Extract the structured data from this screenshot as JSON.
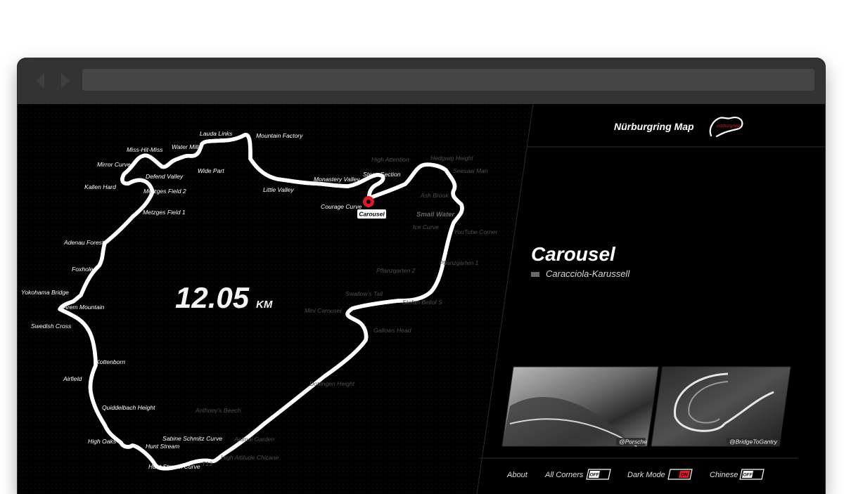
{
  "browser": {
    "back_icon": "chevron-left-icon",
    "forward_icon": "chevron-right-icon",
    "url": ""
  },
  "map": {
    "distance_value": "12.05",
    "distance_unit": "KM",
    "selected_marker_label": "Carousel",
    "corners": [
      {
        "name": "Lauda Links",
        "active": true
      },
      {
        "name": "Mountain Factory",
        "active": true
      },
      {
        "name": "Miss-Hit-Miss",
        "active": true
      },
      {
        "name": "Water Mill",
        "active": true
      },
      {
        "name": "Mirror Curve",
        "active": true
      },
      {
        "name": "Wide Part",
        "active": true
      },
      {
        "name": "Defend Valley",
        "active": true
      },
      {
        "name": "Kallen Hard",
        "active": true
      },
      {
        "name": "Metzges Field 2",
        "active": true
      },
      {
        "name": "Little Valley",
        "active": true
      },
      {
        "name": "Monastery Valley",
        "active": true
      },
      {
        "name": "Steep Section",
        "active": true
      },
      {
        "name": "Courage Curve",
        "active": true
      },
      {
        "name": "Metzges Field 1",
        "active": true
      },
      {
        "name": "Adenau Forest",
        "active": true
      },
      {
        "name": "Foxhole",
        "active": true
      },
      {
        "name": "Yokohama Bridge",
        "active": true
      },
      {
        "name": "Arem Mountain",
        "active": true
      },
      {
        "name": "Swedish Cross",
        "active": true
      },
      {
        "name": "Kottenborn",
        "active": true
      },
      {
        "name": "Airfield",
        "active": true
      },
      {
        "name": "Quiddelbach Height",
        "active": true
      },
      {
        "name": "High Oaks",
        "active": true
      },
      {
        "name": "Sabine Schmitz Curve",
        "active": true
      },
      {
        "name": "Hunt Stream",
        "active": true
      },
      {
        "name": "Hunt Stream Curve",
        "active": true
      },
      {
        "name": "High Attention",
        "active": false
      },
      {
        "name": "Hedgwig Height",
        "active": false
      },
      {
        "name": "Seesaw Man",
        "active": false
      },
      {
        "name": "Ash Brook",
        "active": false
      },
      {
        "name": "Small Water",
        "active": false
      },
      {
        "name": "Ice Curve",
        "active": false
      },
      {
        "name": "YouTube Corner",
        "active": false
      },
      {
        "name": "Pflanzgarten 2",
        "active": false
      },
      {
        "name": "Pflanzgarten 1",
        "active": false
      },
      {
        "name": "Swallow's Tail",
        "active": false
      },
      {
        "name": "Stefan Bellof S",
        "active": false
      },
      {
        "name": "Mini Carousel",
        "active": false
      },
      {
        "name": "Gallows Head",
        "active": false
      },
      {
        "name": "Dottingen Height",
        "active": false
      },
      {
        "name": "Anthony's Beech",
        "active": false
      },
      {
        "name": "Animal Garden",
        "active": false
      },
      {
        "name": "T13",
        "active": false
      },
      {
        "name": "High Altitude Chicane",
        "active": false
      }
    ]
  },
  "panel": {
    "brand_title": "Nürburgring Map",
    "logo_text": "nürburgring",
    "corner_title": "Carousel",
    "corner_subtitle": "Caracciola-Karussell",
    "photos": [
      {
        "credit": "@Porsche"
      },
      {
        "credit": "@BridgeToGantry"
      }
    ]
  },
  "footer": {
    "about_label": "About",
    "toggles": [
      {
        "label": "All Corners",
        "state": "OFF",
        "on": false
      },
      {
        "label": "Dark Mode",
        "state": "ON",
        "on": true
      },
      {
        "label": "Chinese",
        "state": "OFF",
        "on": false
      }
    ]
  },
  "colors": {
    "accent_red": "#e0192a",
    "background": "#000000",
    "track": "#ffffff",
    "dim_label": "#4d4d4d"
  }
}
